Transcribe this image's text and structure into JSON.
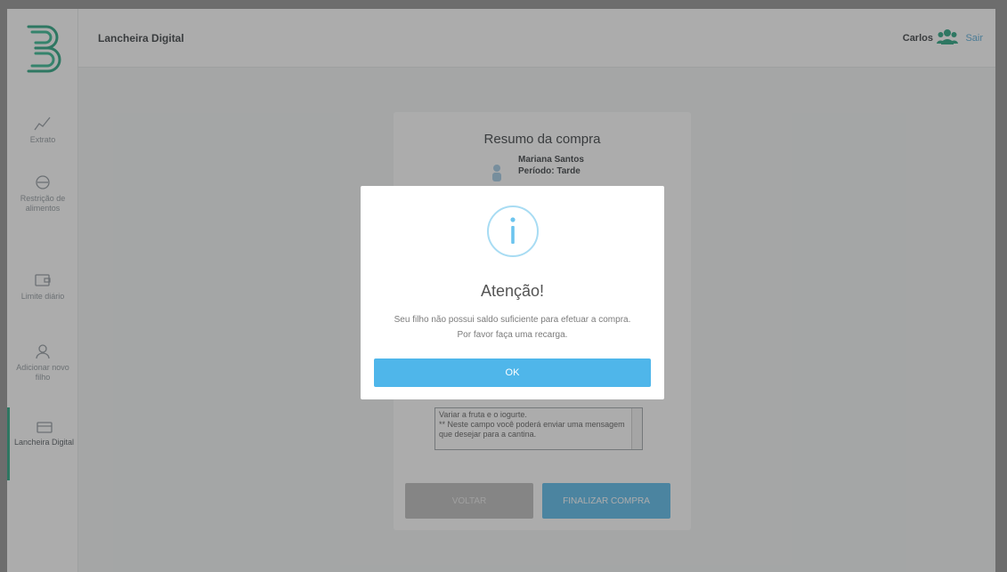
{
  "header": {
    "app_title": "Lancheira Digital",
    "user_name": "Carlos",
    "logout_label": "Sair"
  },
  "sidebar": {
    "items": [
      {
        "label": "Extrato",
        "icon": "line-chart-icon"
      },
      {
        "label": "Restrição de alimentos",
        "icon": "restriction-icon"
      },
      {
        "label": "Limite diário",
        "icon": "wallet-icon"
      },
      {
        "label": "Adicionar novo filho",
        "icon": "add-user-icon"
      },
      {
        "label": "Lancheira Digital",
        "icon": "lunchbox-icon"
      }
    ]
  },
  "purchase": {
    "title": "Resumo da compra",
    "child_name": "Mariana Santos",
    "child_period": "Período: Tarde",
    "notes_text": "Variar a fruta e o iogurte.\n** Neste campo você poderá enviar uma mensagem que desejar para a cantina.",
    "back_label": "VOLTAR",
    "finish_label": "FINALIZAR COMPRA"
  },
  "modal": {
    "icon": "info-icon",
    "title": "Atenção!",
    "message": "Seu filho não possui saldo suficiente para efetuar a compra. Por favor faça uma recarga.",
    "ok_label": "OK"
  },
  "colors": {
    "accent": "#4fb6ea",
    "brand_green": "#1b9e78",
    "overlay": "#8c8c8c"
  }
}
